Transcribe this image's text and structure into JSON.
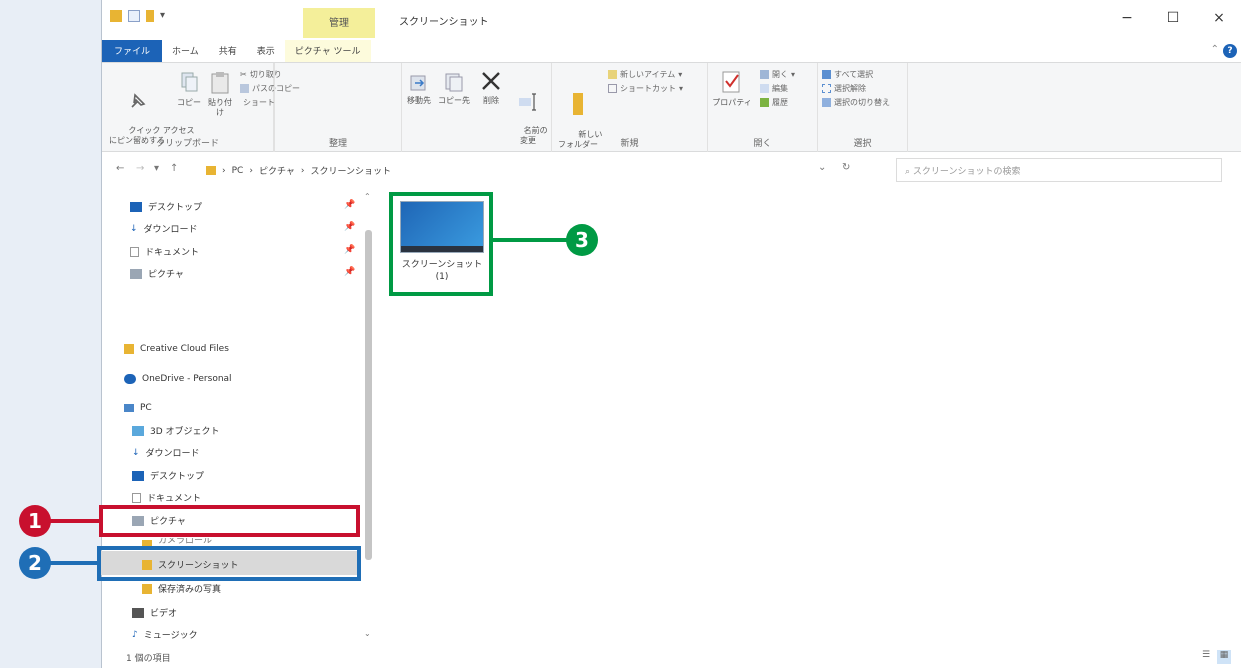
{
  "window": {
    "title": "スクリーンショット",
    "context_tab": "管理",
    "min": "−",
    "max": "☐",
    "close": "×"
  },
  "tabs": [
    "ファイル",
    "ホーム",
    "共有",
    "表示",
    "ピクチャ ツール"
  ],
  "ribbon": {
    "clipboard": {
      "pin": "クイック アクセス\nにピン留めする",
      "copy": "コピー",
      "paste": "貼り付け",
      "cut": "切り取り",
      "copy_path": "パスのコピー",
      "paste_shortcut": "ショートカットの貼り付け",
      "label": "クリップボード"
    },
    "organize": {
      "move_to": "移動先",
      "copy_to": "コピー先",
      "delete": "削除",
      "rename": "名前の\n変更",
      "label": "整理"
    },
    "new": {
      "new_folder": "新しい\nフォルダー",
      "new_item": "新しいアイテム",
      "shortcut": "ショートカット",
      "label": "新規"
    },
    "open": {
      "properties": "プロパティ",
      "open": "開く",
      "edit": "編集",
      "history": "履歴",
      "label": "開く"
    },
    "select": {
      "select_all": "すべて選択",
      "select_none": "選択解除",
      "invert": "選択の切り替え",
      "label": "選択"
    }
  },
  "address": {
    "path": [
      "PC",
      "ピクチャ",
      "スクリーンショット"
    ],
    "search_placeholder": "スクリーンショットの検索"
  },
  "nav": {
    "quick": [
      "デスクトップ",
      "ダウンロード",
      "ドキュメント",
      "ピクチャ"
    ],
    "creative_cloud": "Creative Cloud Files",
    "onedrive": "OneDrive - Personal",
    "pc": "PC",
    "pc_items": [
      "3D オブジェクト",
      "ダウンロード",
      "デスクトップ",
      "ドキュメント",
      "ピクチャ"
    ],
    "picture_children": [
      "カメラロール",
      "スクリーンショット",
      "保存済みの写真"
    ],
    "videos": "ビデオ",
    "music": "ミュージック"
  },
  "content": {
    "file_name": "スクリーンショット\n(1)"
  },
  "status": "1 個の項目",
  "callouts": [
    "1",
    "2",
    "3"
  ],
  "colors": {
    "callout1": "#c8102e",
    "callout2": "#1f6eb6",
    "callout3": "#009a44"
  }
}
